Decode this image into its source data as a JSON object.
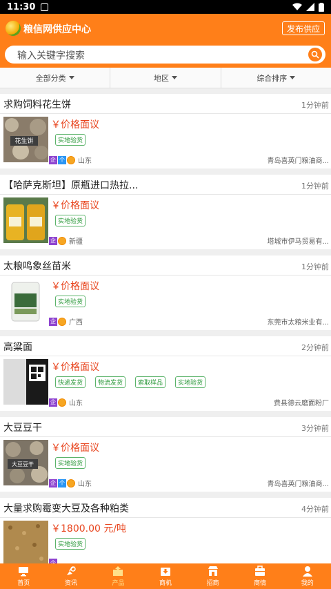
{
  "status": {
    "time": "11:30"
  },
  "header": {
    "title": "粮信网供应中心",
    "publish": "发布供应",
    "search_placeholder": "输入关键字搜索",
    "accent": "#ff7f19"
  },
  "filters": [
    "全部分类",
    "地区",
    "综合排序"
  ],
  "items": [
    {
      "title": "求购饲料花生饼",
      "time": "1分钟前",
      "price": "￥价格面议",
      "tags": [
        "实地验货"
      ],
      "badges": [
        "企",
        "个",
        "金"
      ],
      "region": "山东",
      "company": "青岛喜英门粮油商...",
      "thumb_label": "花生饼"
    },
    {
      "title": "【哈萨克斯坦】原瓶进口热拉...",
      "time": "1分钟前",
      "price": "￥价格面议",
      "tags": [
        "实地验货"
      ],
      "badges": [
        "企",
        "金"
      ],
      "region": "新疆",
      "company": "塔城市伊马贸易有...",
      "thumb_label": ""
    },
    {
      "title": "太粮鸣象丝苗米",
      "time": "1分钟前",
      "price": "￥价格面议",
      "tags": [
        "实地验货"
      ],
      "badges": [
        "企",
        "金"
      ],
      "region": "广西",
      "company": "东莞市太粮米业有...",
      "thumb_label": ""
    },
    {
      "title": "高粱面",
      "time": "2分钟前",
      "price": "￥价格面议",
      "tags": [
        "快递发货",
        "物流发货",
        "索取样品",
        "实地验货"
      ],
      "badges": [
        "企",
        "金"
      ],
      "region": "山东",
      "company": "费县德云磨面粉厂",
      "thumb_label": ""
    },
    {
      "title": "大豆豆干",
      "time": "3分钟前",
      "price": "￥价格面议",
      "tags": [
        "实地验货"
      ],
      "badges": [
        "企",
        "个",
        "金"
      ],
      "region": "山东",
      "company": "青岛喜英门粮油商...",
      "thumb_label": "大豆豆干"
    },
    {
      "title": "大量求购霉变大豆及各种粕类",
      "time": "4分钟前",
      "price": "￥1800.00 元/吨",
      "tags": [
        "实地验货"
      ],
      "badges": [
        "企"
      ],
      "region": "",
      "company": "",
      "thumb_label": ""
    }
  ],
  "tabbar": [
    {
      "label": "首页",
      "icon": "monitor-icon"
    },
    {
      "label": "资讯",
      "icon": "satellite-icon"
    },
    {
      "label": "产品",
      "icon": "upload-box-icon",
      "active": true
    },
    {
      "label": "商机",
      "icon": "download-box-icon"
    },
    {
      "label": "招商",
      "icon": "shop-icon"
    },
    {
      "label": "商情",
      "icon": "briefcase-icon"
    },
    {
      "label": "我的",
      "icon": "person-icon"
    }
  ]
}
